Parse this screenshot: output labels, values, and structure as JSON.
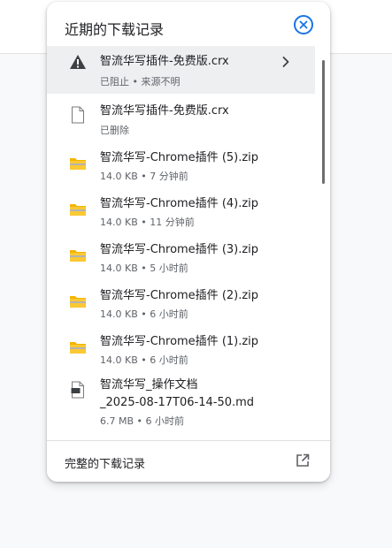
{
  "panel": {
    "title": "近期的下载记录",
    "close_icon": "close-circle-icon",
    "footer_label": "完整的下载记录",
    "footer_icon": "open-external-icon"
  },
  "downloads": [
    {
      "name": "智流华写插件-免费版.crx",
      "status": "已阻止 • 来源不明",
      "icon": "warning-icon",
      "selected": true
    },
    {
      "name": "智流华写插件-免费版.crx",
      "status": "已删除",
      "icon": "file-icon"
    },
    {
      "name": "智流华写-Chrome插件 (5).zip",
      "status": "14.0 KB • 7 分钟前",
      "icon": "zip-folder-icon"
    },
    {
      "name": "智流华写-Chrome插件 (4).zip",
      "status": "14.0 KB • 11 分钟前",
      "icon": "zip-folder-icon"
    },
    {
      "name": "智流华写-Chrome插件 (3).zip",
      "status": "14.0 KB • 5 小时前",
      "icon": "zip-folder-icon"
    },
    {
      "name": "智流华写-Chrome插件 (2).zip",
      "status": "14.0 KB • 6 小时前",
      "icon": "zip-folder-icon"
    },
    {
      "name": "智流华写-Chrome插件 (1).zip",
      "status": "14.0 KB • 6 小时前",
      "icon": "zip-folder-icon"
    },
    {
      "name": "智流华写_操作文档\n_2025-08-17T06-14-50.md",
      "status": "6.7 MB • 6 小时前",
      "icon": "md-file-icon"
    }
  ]
}
